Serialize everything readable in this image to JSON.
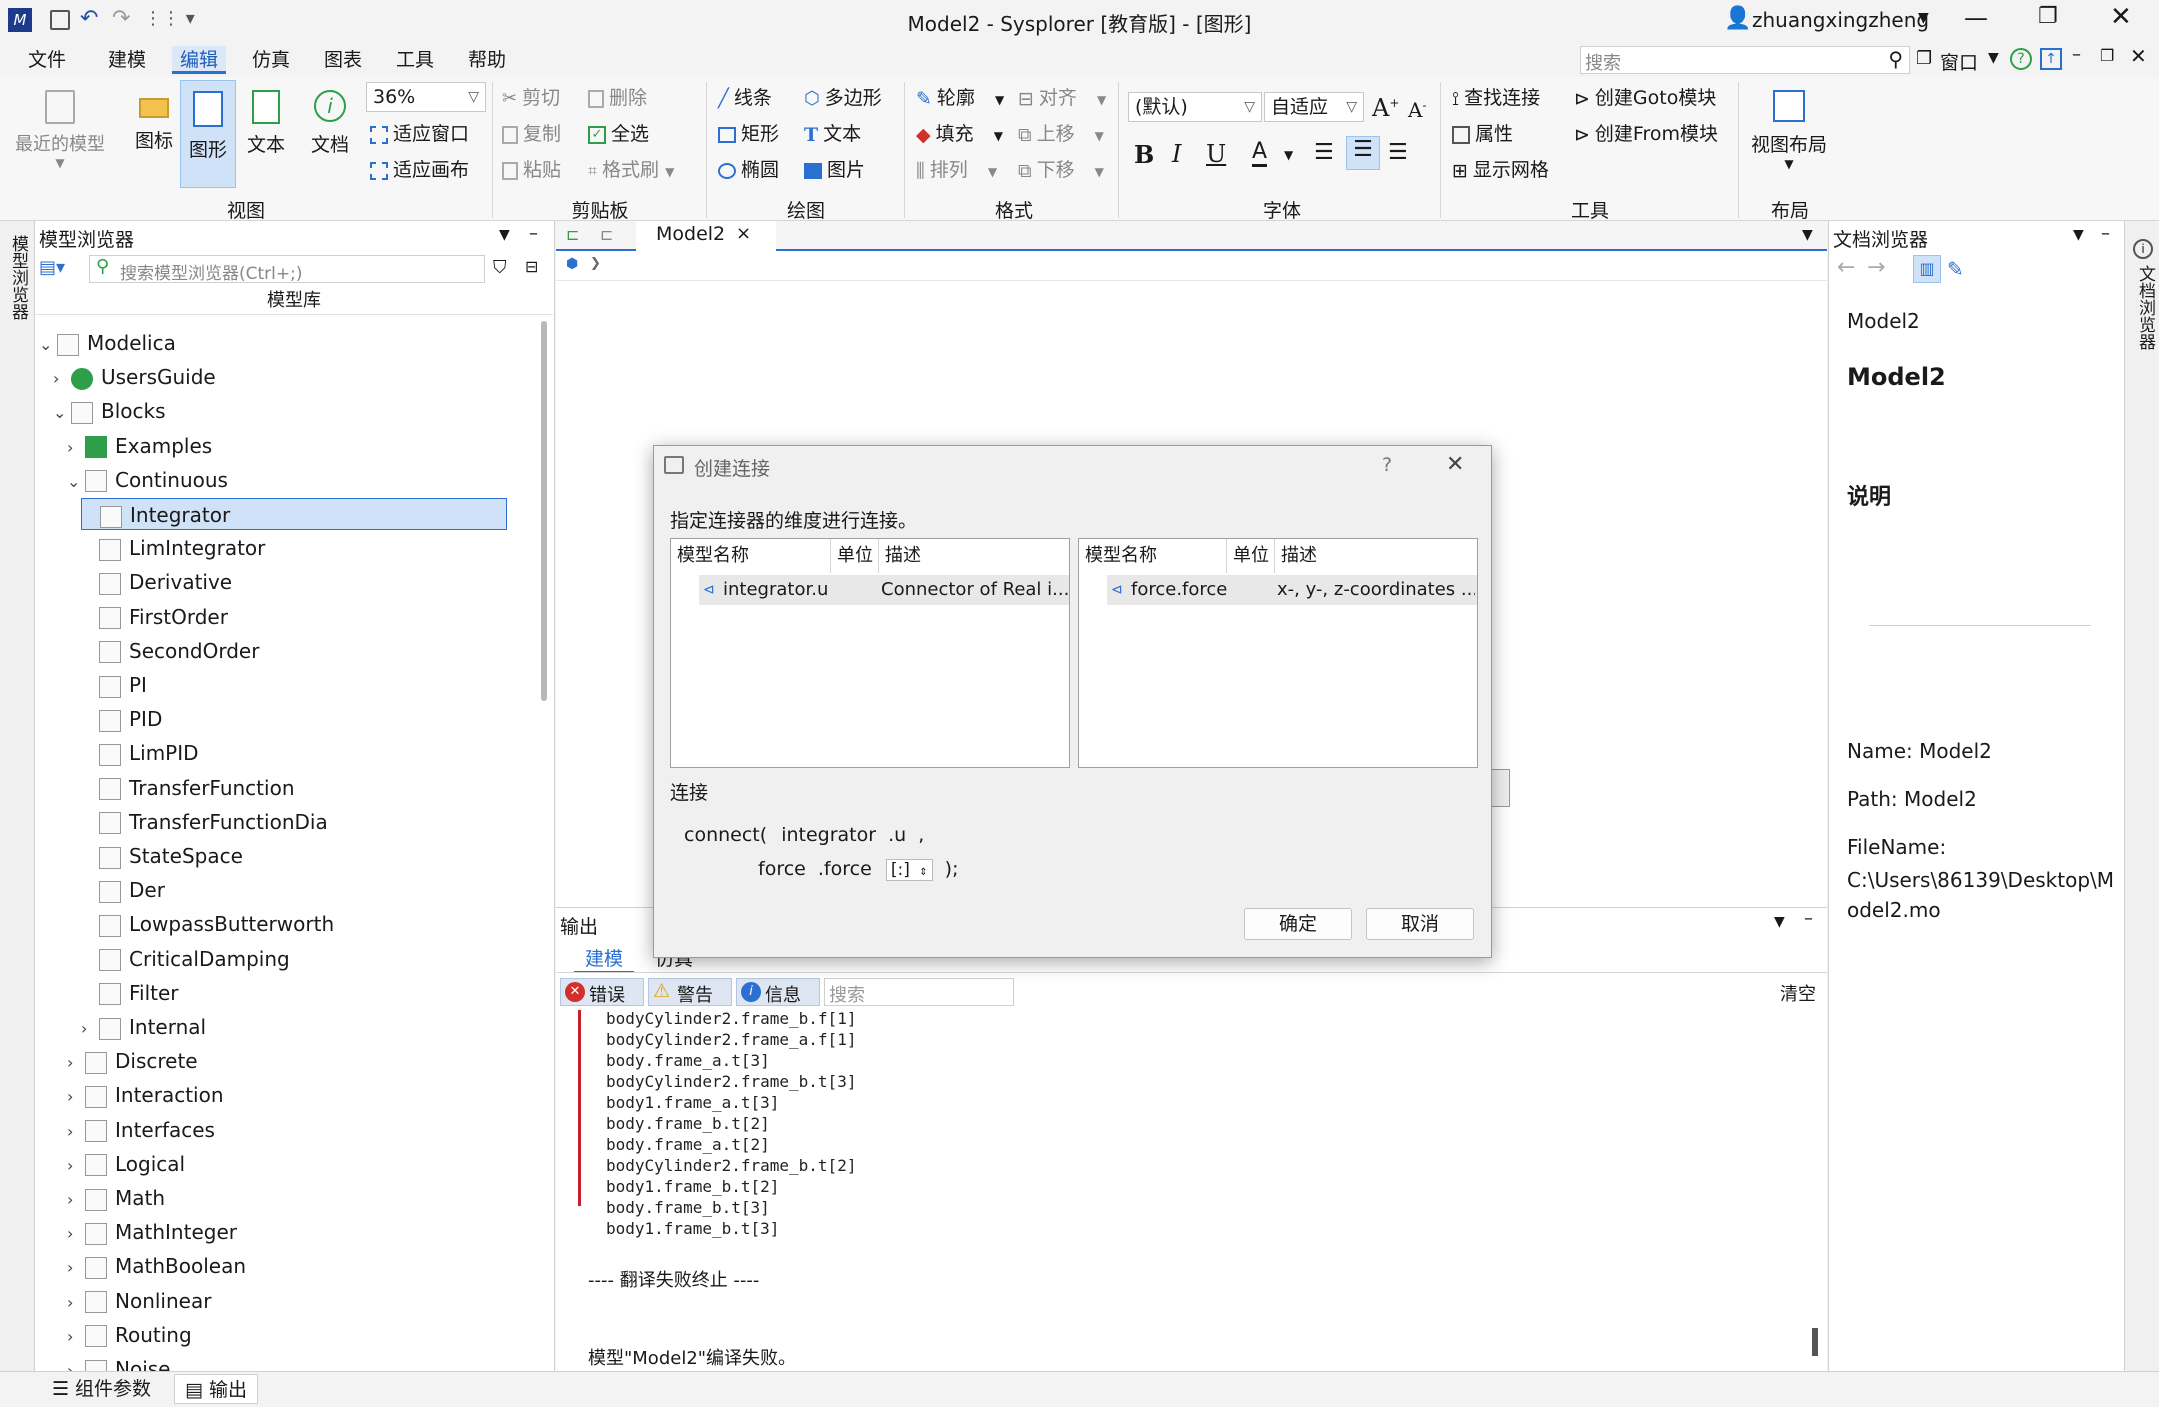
{
  "window": {
    "title": "Model2 - Sysplorer [教育版] - [图形]",
    "user": "zhuangxingzheng"
  },
  "menu": [
    "文件",
    "建模",
    "编辑",
    "仿真",
    "图表",
    "工具",
    "帮助"
  ],
  "menu_search_placeholder": "搜索",
  "menu_right": {
    "window": "窗口"
  },
  "ribbon": {
    "view": {
      "recent": "最近的模型",
      "icon": "图标",
      "diagram": "图形",
      "text": "文本",
      "doc": "文档",
      "zoom": "36%",
      "fit_window": "适应窗口",
      "fit_canvas": "适应画布",
      "group": "视图"
    },
    "clipboard": {
      "cut": "剪切",
      "delete": "删除",
      "copy": "复制",
      "select_all": "全选",
      "paste": "粘贴",
      "format_brush": "格式刷",
      "group": "剪贴板"
    },
    "draw": {
      "line": "线条",
      "polygon": "多边形",
      "rect": "矩形",
      "text": "文本",
      "ellipse": "椭圆",
      "image": "图片",
      "group": "绘图"
    },
    "format": {
      "outline": "轮廓",
      "align": "对齐",
      "fill": "填充",
      "move_up": "上移",
      "arrange": "排列",
      "move_down": "下移",
      "group": "格式"
    },
    "font": {
      "family": "(默认)",
      "size": "自适应",
      "group": "字体"
    },
    "tools": {
      "find_conn": "查找连接",
      "create_goto": "创建Goto模块",
      "props": "属性",
      "create_from": "创建From模块",
      "show_grid": "显示网格",
      "group": "工具"
    },
    "layout": {
      "view_layout": "视图布局",
      "group": "布局"
    }
  },
  "left_rail": "模型浏览器",
  "right_rail": "文档浏览器",
  "model_browser": {
    "title": "模型浏览器",
    "search_placeholder": "搜索模型浏览器(Ctrl+;)",
    "lib_header": "模型库",
    "tree": [
      {
        "label": "Modelica",
        "level": 0,
        "exp": "v"
      },
      {
        "label": "UsersGuide",
        "level": 1,
        "exp": ">"
      },
      {
        "label": "Blocks",
        "level": 1,
        "exp": "v"
      },
      {
        "label": "Examples",
        "level": 2,
        "exp": ">"
      },
      {
        "label": "Continuous",
        "level": 2,
        "exp": "v"
      },
      {
        "label": "Integrator",
        "level": 3,
        "exp": "",
        "selected": true
      },
      {
        "label": "LimIntegrator",
        "level": 3,
        "exp": ""
      },
      {
        "label": "Derivative",
        "level": 3,
        "exp": ""
      },
      {
        "label": "FirstOrder",
        "level": 3,
        "exp": ""
      },
      {
        "label": "SecondOrder",
        "level": 3,
        "exp": ""
      },
      {
        "label": "PI",
        "level": 3,
        "exp": ""
      },
      {
        "label": "PID",
        "level": 3,
        "exp": ""
      },
      {
        "label": "LimPID",
        "level": 3,
        "exp": ""
      },
      {
        "label": "TransferFunction",
        "level": 3,
        "exp": ""
      },
      {
        "label": "TransferFunctionDia",
        "level": 3,
        "exp": ""
      },
      {
        "label": "StateSpace",
        "level": 3,
        "exp": ""
      },
      {
        "label": "Der",
        "level": 3,
        "exp": ""
      },
      {
        "label": "LowpassButterworth",
        "level": 3,
        "exp": ""
      },
      {
        "label": "CriticalDamping",
        "level": 3,
        "exp": ""
      },
      {
        "label": "Filter",
        "level": 3,
        "exp": ""
      },
      {
        "label": "Internal",
        "level": 3,
        "exp": ">"
      },
      {
        "label": "Discrete",
        "level": 2,
        "exp": ">"
      },
      {
        "label": "Interaction",
        "level": 2,
        "exp": ">"
      },
      {
        "label": "Interfaces",
        "level": 2,
        "exp": ">"
      },
      {
        "label": "Logical",
        "level": 2,
        "exp": ">"
      },
      {
        "label": "Math",
        "level": 2,
        "exp": ">"
      },
      {
        "label": "MathInteger",
        "level": 2,
        "exp": ">"
      },
      {
        "label": "MathBoolean",
        "level": 2,
        "exp": ">"
      },
      {
        "label": "Nonlinear",
        "level": 2,
        "exp": ">"
      },
      {
        "label": "Routing",
        "level": 2,
        "exp": ">"
      },
      {
        "label": "Noise",
        "level": 2,
        "exp": ">"
      }
    ]
  },
  "editor": {
    "tab": "Model2",
    "close": "×"
  },
  "output": {
    "title": "输出",
    "tabs": [
      "建模",
      "仿真"
    ],
    "filters": {
      "error": "错误",
      "warning": "警告",
      "info": "信息"
    },
    "search_placeholder": "搜索",
    "clear": "清空",
    "lines": [
      "bodyCylinder2.frame_b.f[1]",
      "bodyCylinder2.frame_a.f[1]",
      "body.frame_a.t[3]",
      "bodyCylinder2.frame_b.t[3]",
      "body1.frame_a.t[3]",
      "body.frame_b.t[2]",
      "body.frame_a.t[2]",
      "bodyCylinder2.frame_b.t[2]",
      "body1.frame_b.t[2]",
      "body.frame_b.t[3]",
      "body1.frame_b.t[3]"
    ],
    "fail_line": "---- 翻译失败终止 ----",
    "result_line": "模型\"Model2\"编译失败。"
  },
  "doc_browser": {
    "title": "文档浏览器",
    "name_small": "Model2",
    "name_big": "Model2",
    "desc_heading": "说明",
    "name_line": "Name: Model2",
    "path_line": "Path: Model2",
    "filename_label": "FileName:",
    "filename_value": "C:\\Users\\86139\\Desktop\\Model2.mo"
  },
  "status": {
    "params": "组件参数",
    "output": "输出"
  },
  "dialog": {
    "title": "创建连接",
    "help": "?",
    "close": "✕",
    "instruction": "指定连接器的维度进行连接。",
    "left_table": {
      "headers": [
        "模型名称",
        "单位",
        "描述"
      ],
      "row": {
        "name": "integrator.u",
        "unit": "",
        "desc": "Connector of Real i..."
      }
    },
    "right_table": {
      "headers": [
        "模型名称",
        "单位",
        "描述"
      ],
      "row": {
        "name": "force.force",
        "unit": "",
        "desc": "x-, y-, z-coordinates ..."
      }
    },
    "connect_label": "连接",
    "line1": {
      "fn": "connect(",
      "a": "integrator",
      "b": ".u",
      "c": ","
    },
    "line2": {
      "a": "force",
      ".b": ".force",
      "dim": "[:]",
      "end": ");"
    },
    "ok": "确定",
    "cancel": "取消"
  }
}
